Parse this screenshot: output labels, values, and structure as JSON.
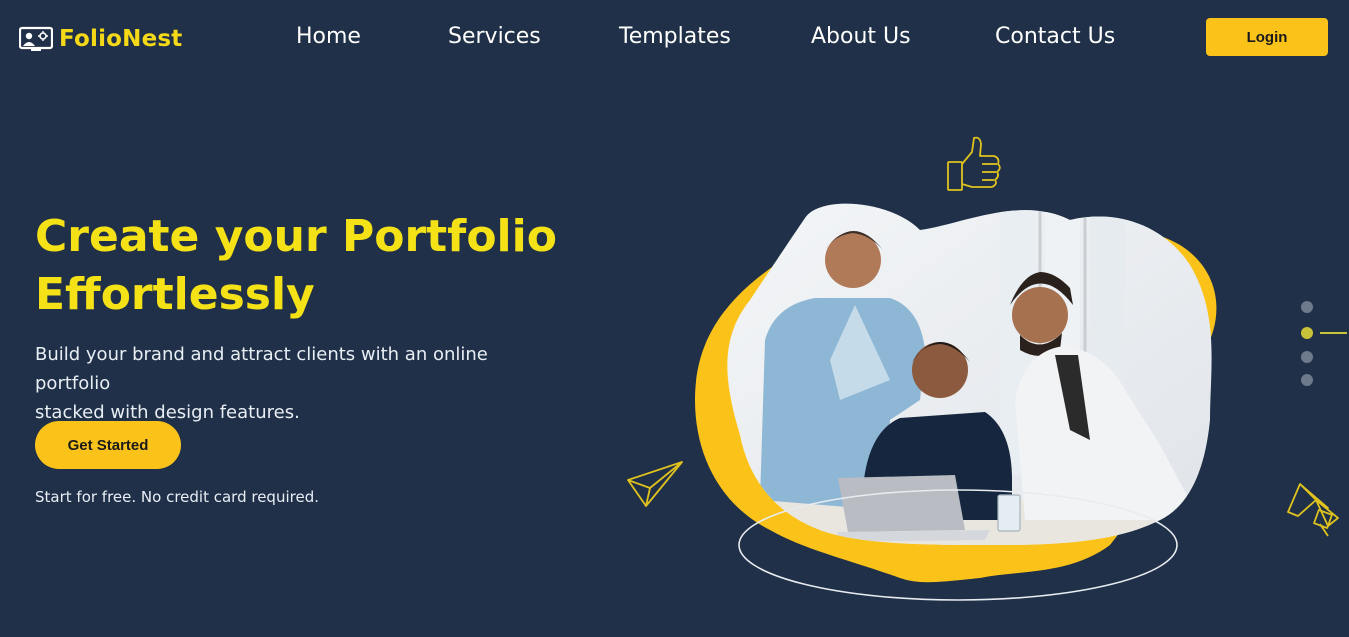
{
  "brand": {
    "name": "FolioNest",
    "logo_icon": "team-presentation-icon"
  },
  "nav": {
    "items": [
      {
        "label": "Home"
      },
      {
        "label": "Services"
      },
      {
        "label": "Templates"
      },
      {
        "label": "About Us"
      },
      {
        "label": "Contact Us"
      }
    ],
    "login_label": "Login"
  },
  "hero": {
    "title_line1": "Create your Portfolio",
    "title_line2": "Effortlessly",
    "subtitle_line1": "Build your brand and attract clients with an online portfolio",
    "subtitle_line2": "stacked with design features.",
    "cta_label": "Get Started",
    "cta_note": "Start for free. No credit card required."
  },
  "carousel": {
    "slide_count": 4,
    "active_index": 1
  },
  "decor_icons": [
    "thumbs-up-icon",
    "paper-plane-icon",
    "megaphone-icon"
  ],
  "colors": {
    "background": "#1f3048",
    "accent": "#fbc31a",
    "title": "#f5e216",
    "text": "#ffffff"
  }
}
